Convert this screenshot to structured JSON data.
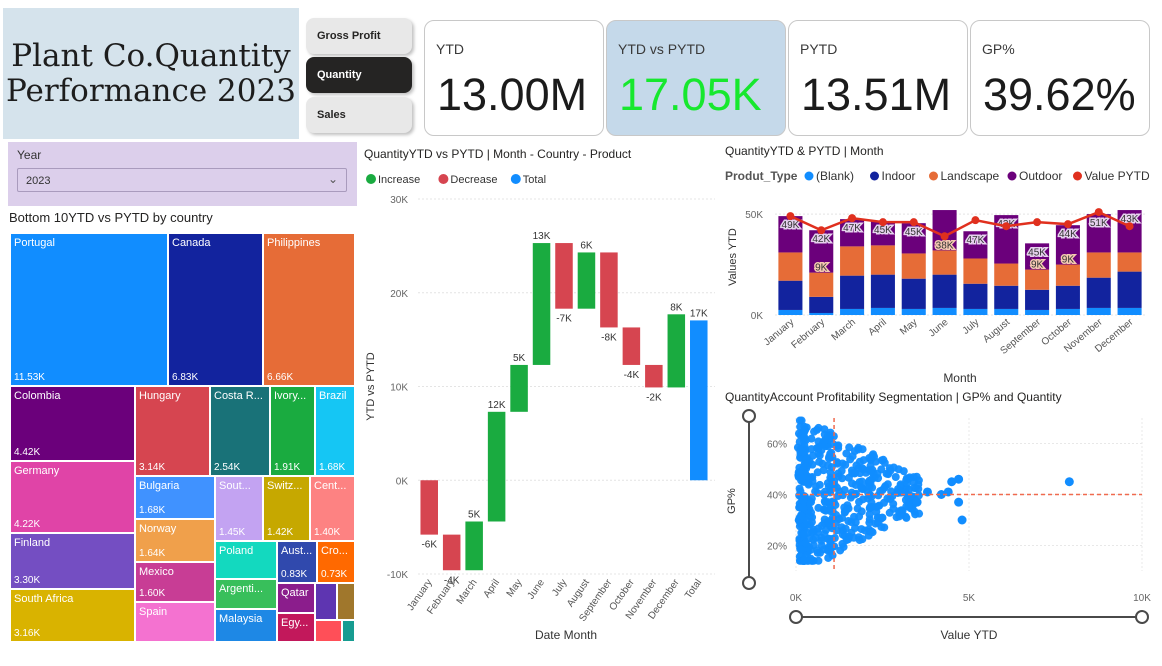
{
  "report": {
    "title": "Plant Co.Quantity\nPerformance 2023"
  },
  "nav": {
    "buttons": [
      "Gross Profit",
      "Quantity",
      "Sales"
    ],
    "active": 1
  },
  "kpis": [
    {
      "label": "YTD",
      "value": "13.00M"
    },
    {
      "label": "YTD vs PYTD",
      "value": "17.05K",
      "value_color": "#17e82e"
    },
    {
      "label": "PYTD",
      "value": "13.51M"
    },
    {
      "label": "GP%",
      "value": "39.62%"
    }
  ],
  "slicer": {
    "label": "Year",
    "value": "2023"
  },
  "treemap": {
    "title": "Bottom 10YTD vs PYTD by country",
    "items": [
      {
        "name": "Portugal",
        "value": "11.53K",
        "color": "#118dff"
      },
      {
        "name": "Canada",
        "value": "6.83K",
        "color": "#12239e"
      },
      {
        "name": "Philippines",
        "value": "6.66K",
        "color": "#e66c37"
      },
      {
        "name": "Colombia",
        "value": "4.42K",
        "color": "#6b007b"
      },
      {
        "name": "Hungary",
        "value": "3.14K",
        "color": "#d64550"
      },
      {
        "name": "Costa R...",
        "value": "2.54K",
        "color": "#197278"
      },
      {
        "name": "Ivory...",
        "value": "1.91K",
        "color": "#1aab40"
      },
      {
        "name": "Brazil",
        "value": "1.68K",
        "color": "#15c6f4"
      },
      {
        "name": "Germany",
        "value": "4.22K",
        "color": "#e044a7"
      },
      {
        "name": "Finland",
        "value": "3.30K",
        "color": "#744ec2"
      },
      {
        "name": "South Africa",
        "value": "3.16K",
        "color": "#d9b300"
      },
      {
        "name": "Bulgaria",
        "value": "1.68K",
        "color": "#4092ff"
      },
      {
        "name": "Sout...",
        "value": "1.45K",
        "color": "#c3a3f2"
      },
      {
        "name": "Switz...",
        "value": "1.42K",
        "color": "#c6a800"
      },
      {
        "name": "Cent...",
        "value": "1.40K",
        "color": "#fd8282"
      },
      {
        "name": "Norway",
        "value": "1.64K",
        "color": "#f0a04b"
      },
      {
        "name": "Mexico",
        "value": "1.60K",
        "color": "#c83d95"
      },
      {
        "name": "Spain",
        "value": "",
        "color": "#f472d0"
      },
      {
        "name": "Poland",
        "value": "",
        "color": "#13d9bf"
      },
      {
        "name": "Aust...",
        "value": "0.83K",
        "color": "#3049ad"
      },
      {
        "name": "Cro...",
        "value": "0.73K",
        "color": "#ff6900"
      },
      {
        "name": "Argenti...",
        "value": "",
        "color": "#38bf5b"
      },
      {
        "name": "Qatar",
        "value": "",
        "color": "#8b1d8c"
      },
      {
        "name": "Malaysia",
        "value": "",
        "color": "#1e88e5"
      },
      {
        "name": "Egy...",
        "value": "",
        "color": "#c2185b"
      },
      {
        "name": "",
        "value": "",
        "color": "#5e35b1"
      },
      {
        "name": "",
        "value": "",
        "color": "#a0772c"
      },
      {
        "name": "",
        "value": "",
        "color": "#ff4f58"
      },
      {
        "name": "",
        "value": "",
        "color": "#179c91"
      }
    ]
  },
  "waterfall_title": "QuantityYTD vs PYTD | Month - Country - Product",
  "combo_title": "QuantityYTD & PYTD | Month",
  "scatter_title": "QuantityAccount Profitability Segmentation | GP% and Quantity",
  "chart_data": [
    {
      "type": "bar",
      "subtype": "waterfall",
      "title": "QuantityYTD vs PYTD | Month - Country - Product",
      "xlabel": "Date Month",
      "ylabel": "YTD vs PYTD",
      "ylim": [
        -10000,
        30000
      ],
      "yticks": [
        "-10K",
        "0K",
        "10K",
        "20K",
        "30K"
      ],
      "legend": [
        {
          "name": "Increase",
          "color": "#1aab40"
        },
        {
          "name": "Decrease",
          "color": "#d64550"
        },
        {
          "name": "Total",
          "color": "#118dff"
        }
      ],
      "legend_position": "top-left",
      "categories": [
        "January",
        "February",
        "March",
        "April",
        "May",
        "June",
        "July",
        "August",
        "September",
        "October",
        "November",
        "December",
        "Total"
      ],
      "values": [
        -5800,
        -3800,
        5200,
        11700,
        5000,
        13000,
        -7000,
        6000,
        -8000,
        -4000,
        -2400,
        7800,
        17050
      ],
      "labels": [
        "-6K",
        "-4K",
        "5K",
        "12K",
        "5K",
        "13K",
        "-7K",
        "6K",
        "-8K",
        "-4K",
        "-2K",
        "8K",
        "17K"
      ]
    },
    {
      "type": "bar",
      "subtype": "stacked-bar-with-line",
      "title": "QuantityYTD & PYTD | Month",
      "legend_title": "Produt_Type",
      "legend": [
        {
          "name": "(Blank)",
          "color": "#118dff"
        },
        {
          "name": "Indoor",
          "color": "#12239e"
        },
        {
          "name": "Landscape",
          "color": "#e66c37"
        },
        {
          "name": "Outdoor",
          "color": "#6b007b"
        },
        {
          "name": "Value PYTD",
          "color": "#e0301e"
        }
      ],
      "legend_position": "top",
      "xlabel": "Month",
      "ylabel": "Values YTD",
      "ylim": [
        0,
        55000
      ],
      "yticks": [
        "0K",
        "50K"
      ],
      "categories": [
        "January",
        "February",
        "March",
        "April",
        "May",
        "June",
        "July",
        "August",
        "September",
        "October",
        "November",
        "December"
      ],
      "series": [
        {
          "name": "(Blank)",
          "values": [
            2500,
            1000,
            3000,
            3500,
            3000,
            3500,
            3000,
            3000,
            2500,
            3000,
            3500,
            3500
          ]
        },
        {
          "name": "Indoor",
          "values": [
            14500,
            8000,
            16500,
            16500,
            15000,
            16500,
            12500,
            11500,
            10000,
            11500,
            15000,
            18000
          ]
        },
        {
          "name": "Landscape",
          "values": [
            14000,
            12000,
            14500,
            14500,
            12500,
            12000,
            12500,
            11000,
            10000,
            10500,
            12500,
            9500
          ]
        },
        {
          "name": "Outdoor",
          "values": [
            18000,
            21000,
            13500,
            12000,
            15000,
            20000,
            13500,
            24000,
            13000,
            19500,
            19000,
            21000
          ]
        }
      ],
      "outdoor_labels": [
        "49K",
        "42K",
        "47K",
        "45K",
        "45K",
        "",
        "47K",
        "43K",
        "45K",
        "44K",
        "51K",
        "43K"
      ],
      "small_labels": [
        "",
        "9K",
        "",
        "",
        "",
        "38K",
        "",
        "",
        "9K",
        "9K",
        "",
        ""
      ],
      "line": {
        "name": "Value PYTD",
        "values": [
          49000,
          42000,
          48000,
          46000,
          46000,
          39000,
          47000,
          44000,
          46000,
          45000,
          51000,
          44000
        ]
      }
    },
    {
      "type": "scatter",
      "title": "QuantityAccount Profitability Segmentation | GP% and Quantity",
      "xlabel": "Value YTD",
      "ylabel": "GP%",
      "xlim": [
        0,
        10000
      ],
      "ylim": [
        10,
        70
      ],
      "xticks": [
        "0K",
        "5K",
        "10K"
      ],
      "yticks": [
        "20%",
        "40%",
        "60%"
      ],
      "reference_lines": {
        "x": 1100,
        "y": 40
      },
      "color": "#118dff",
      "point_count": 500,
      "outliers": [
        {
          "x": 7900,
          "y": 45
        },
        {
          "x": 4700,
          "y": 46
        },
        {
          "x": 4500,
          "y": 45
        },
        {
          "x": 4400,
          "y": 41
        },
        {
          "x": 3800,
          "y": 41
        },
        {
          "x": 4700,
          "y": 37
        },
        {
          "x": 4800,
          "y": 30
        },
        {
          "x": 3500,
          "y": 37
        },
        {
          "x": 4200,
          "y": 40
        }
      ]
    }
  ]
}
